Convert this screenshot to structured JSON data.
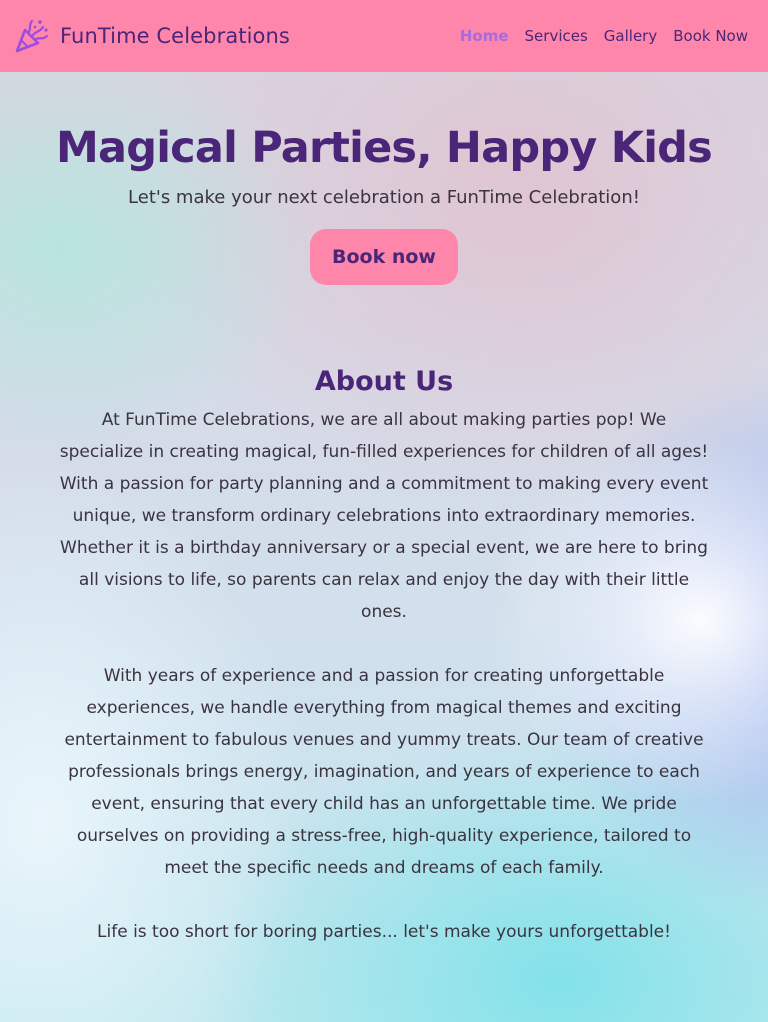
{
  "header": {
    "brand_name": "FunTime Celebrations",
    "brand_icon": "party-popper-icon",
    "nav": [
      {
        "label": "Home",
        "active": true
      },
      {
        "label": "Services",
        "active": false
      },
      {
        "label": "Gallery",
        "active": false
      },
      {
        "label": "Book Now",
        "active": false
      }
    ]
  },
  "hero": {
    "title": "Magical Parties, Happy Kids",
    "subtitle": "Let's make your next celebration a FunTime Celebration!",
    "button_label": "Book now"
  },
  "about": {
    "title": "About Us",
    "paragraphs": [
      "At FunTime Celebrations, we are all about making parties pop! We specialize in creating magical, fun-filled experiences for children of all ages! With a passion for party planning and a commitment to making every event unique, we transform ordinary celebrations into extraordinary memories. Whether it is a birthday anniversary or a special event, we are here to bring all visions to life, so parents can relax and enjoy the day with their little ones.",
      "With years of experience and a passion for creating unforgettable experiences, we handle everything from magical themes and exciting entertainment to fabulous venues and yummy treats. Our team of creative professionals brings energy, imagination, and years of experience to each event, ensuring that every child has an unforgettable time. We pride ourselves on providing a stress-free, high-quality experience, tailored to meet the specific needs and dreams of each family.",
      "Life is too short for boring parties... let's make yours unforgettable!"
    ]
  },
  "colors": {
    "header_bg": "#ff86ab",
    "brand_purple": "#4a2578",
    "active_nav": "#a86bde",
    "body_text": "#3a3340"
  }
}
